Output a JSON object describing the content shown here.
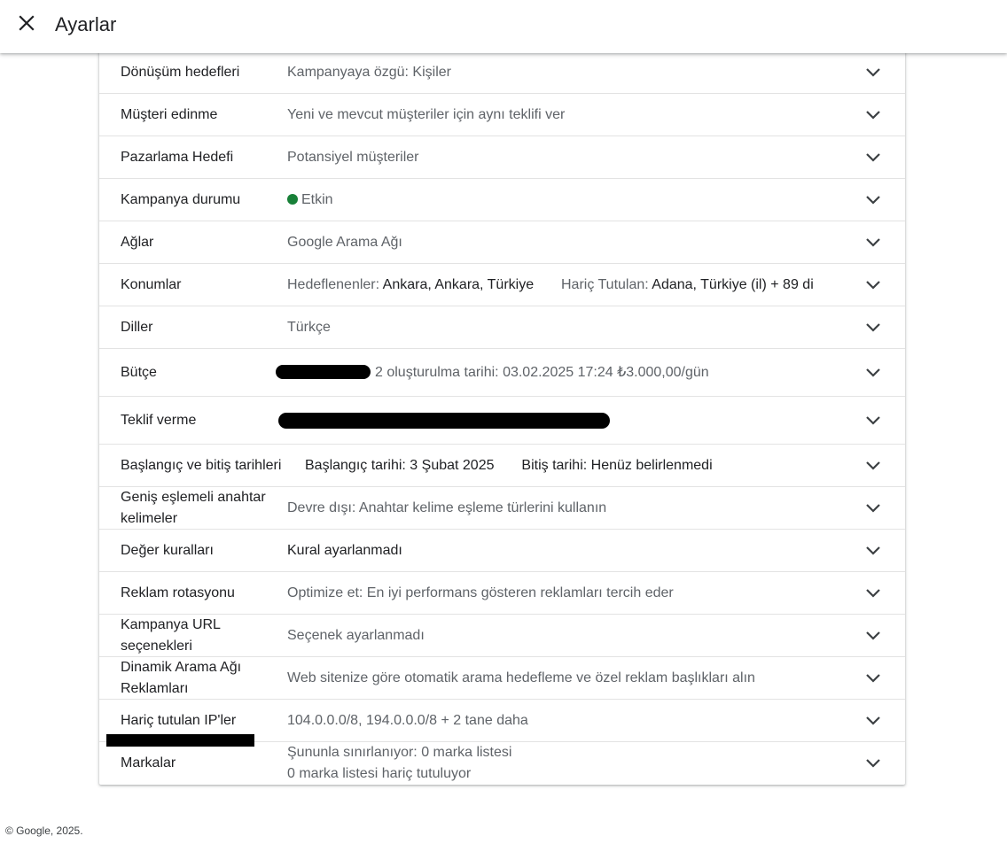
{
  "header": {
    "title": "Ayarlar",
    "close_icon": "close-icon"
  },
  "rows": {
    "donusum": {
      "label": "Dönüşüm hedefleri",
      "value": "Kampanyaya özgü: Kişiler"
    },
    "musteri": {
      "label": "Müşteri edinme",
      "value": "Yeni ve mevcut müşteriler için aynı teklifi ver"
    },
    "pazarlama": {
      "label": "Pazarlama Hedefi",
      "value": "Potansiyel müşteriler"
    },
    "durum": {
      "label": "Kampanya durumu",
      "value": "Etkin",
      "status_color": "#188038"
    },
    "aglar": {
      "label": "Ağlar",
      "value": "Google Arama Ağı"
    },
    "konumlar": {
      "label": "Konumlar",
      "targeted_prefix": "Hedeflenenler:",
      "targeted_value": "Ankara, Ankara, Türkiye",
      "excluded_prefix": "Hariç Tutulan:",
      "excluded_value": "Adana, Türkiye (il) + 89 di"
    },
    "diller": {
      "label": "Diller",
      "value": "Türkçe"
    },
    "butce": {
      "label": "Bütçe",
      "value": "2 oluşturulma tarihi: 03.02.2025 17:24 ₺3.000,00/gün"
    },
    "teklif": {
      "label": "Teklif verme",
      "value": ""
    },
    "tarihler": {
      "label": "Başlangıç ve bitiş tarihleri",
      "start_prefix": "Başlangıç tarihi:",
      "start_value": "3 Şubat 2025",
      "end_prefix": "Bitiş tarihi:",
      "end_value": "Henüz belirlenmedi"
    },
    "genis": {
      "label_line1": "Geniş eşlemeli anahtar",
      "label_line2": "kelimeler",
      "value": "Devre dışı: Anahtar kelime eşleme türlerini kullanın"
    },
    "deger": {
      "label": "Değer kuralları",
      "value": "Kural ayarlanmadı"
    },
    "rotasyon": {
      "label": "Reklam rotasyonu",
      "value": "Optimize et: En iyi performans gösteren reklamları tercih eder"
    },
    "url": {
      "label_line1": "Kampanya URL",
      "label_line2": "seçenekleri",
      "value": "Seçenek ayarlanmadı"
    },
    "dinamik": {
      "label_line1": "Dinamik Arama Ağı",
      "label_line2": "Reklamları",
      "value": "Web sitenize göre otomatik arama hedefleme ve özel reklam başlıkları alın"
    },
    "ip": {
      "label": "Hariç tutulan IP'ler",
      "value": "104.0.0.0/8, 194.0.0.0/8 + 2 tane daha"
    },
    "markalar": {
      "label": "Markalar",
      "value_line1": "Şununla sınırlanıyor: 0 marka listesi",
      "value_line2": "0 marka listesi hariç tutuluyor"
    }
  },
  "footer": {
    "text": "© Google, 2025."
  },
  "colors": {
    "status_green": "#188038",
    "label": "#202124",
    "value": "#5f6368"
  }
}
